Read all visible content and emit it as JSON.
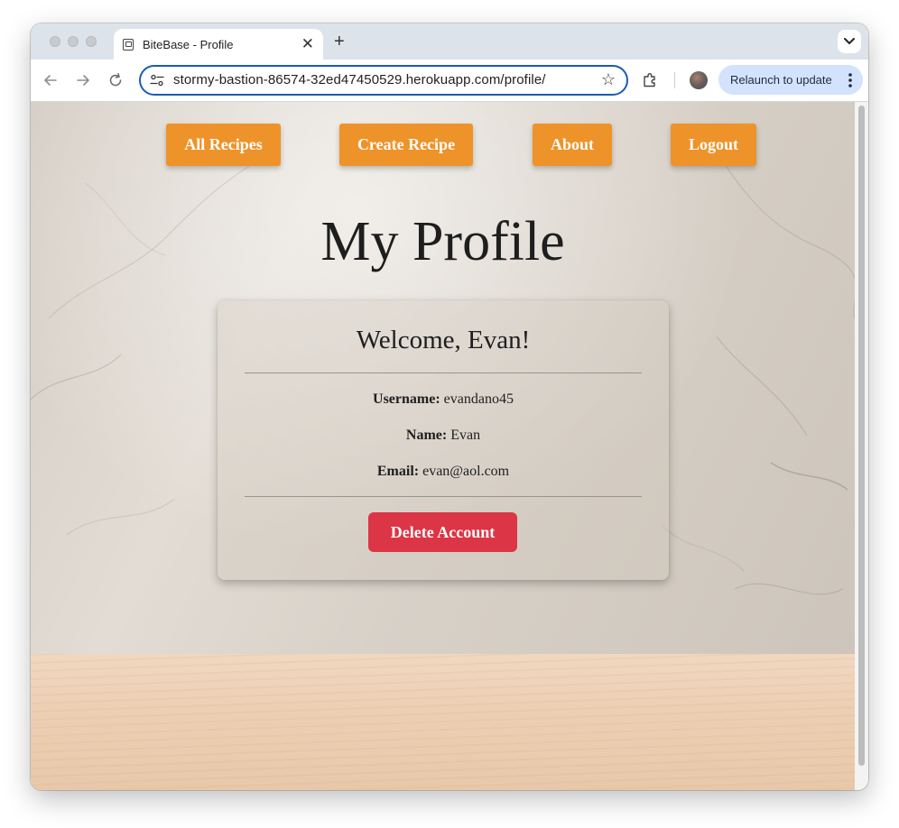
{
  "browser": {
    "tab_title": "BiteBase - Profile",
    "tab_close": "✕",
    "new_tab": "+",
    "url": "stormy-bastion-86574-32ed47450529.herokuapp.com/profile/",
    "star": "☆",
    "relaunch_label": "Relaunch to update"
  },
  "nav": {
    "all_recipes": "All Recipes",
    "create_recipe": "Create Recipe",
    "about": "About",
    "logout": "Logout"
  },
  "page": {
    "title": "My Profile"
  },
  "profile": {
    "welcome": "Welcome, Evan!",
    "username_label": "Username:",
    "username": "evandano45",
    "name_label": "Name:",
    "name": "Evan",
    "email_label": "Email:",
    "email": "evan@aol.com",
    "delete_label": "Delete Account"
  },
  "colors": {
    "nav_button": "#ee9329",
    "delete_button": "#dc3545",
    "omnibox_focus": "#1a5bb8",
    "relaunch_chip": "#d3e3fd"
  }
}
